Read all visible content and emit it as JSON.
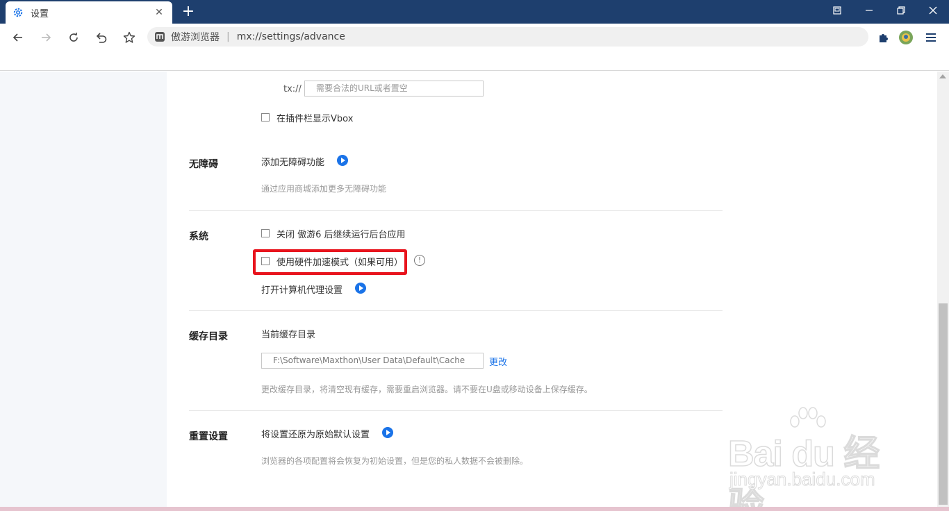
{
  "tab": {
    "title": "设置",
    "close": "✕",
    "new_tab": "+"
  },
  "omnibox": {
    "site_name": "傲游浏览器",
    "separator": "|",
    "url": "mx://settings/advance"
  },
  "proxy": {
    "scheme_label": "tx://",
    "url_placeholder": "需要合法的URL或者置空"
  },
  "vbox": {
    "label": "在插件栏显示Vbox"
  },
  "accessibility": {
    "title": "无障碍",
    "add_label": "添加无障碍功能",
    "description": "通过应用商城添加更多无障碍功能"
  },
  "system": {
    "title": "系统",
    "background_apps_label": "关闭 傲游6 后继续运行后台应用",
    "hardware_accel_label": "使用硬件加速模式（如果可用）",
    "info_glyph": "!",
    "proxy_settings_label": "打开计算机代理设置"
  },
  "cache": {
    "title": "缓存目录",
    "current_label": "当前缓存目录",
    "path_value": "F:\\Software\\Maxthon\\User Data\\Default\\Cache",
    "change_link": "更改",
    "description": "更改缓存目录，将清空现有缓存，需要重启浏览器。请不要在U盘或移动设备上保存缓存。"
  },
  "reset": {
    "title": "重置设置",
    "restore_label": "将设置还原为原始默认设置",
    "description": "浏览器的各项配置将会恢复为初始设置，但是您的私人数据不会被删除。"
  },
  "watermark": {
    "main": "Bai du 经验",
    "sub": "jingyan.baidu.com"
  },
  "colors": {
    "titlebar": "#1e3f6e",
    "accent": "#1a73e8",
    "highlight": "#e8141d"
  }
}
